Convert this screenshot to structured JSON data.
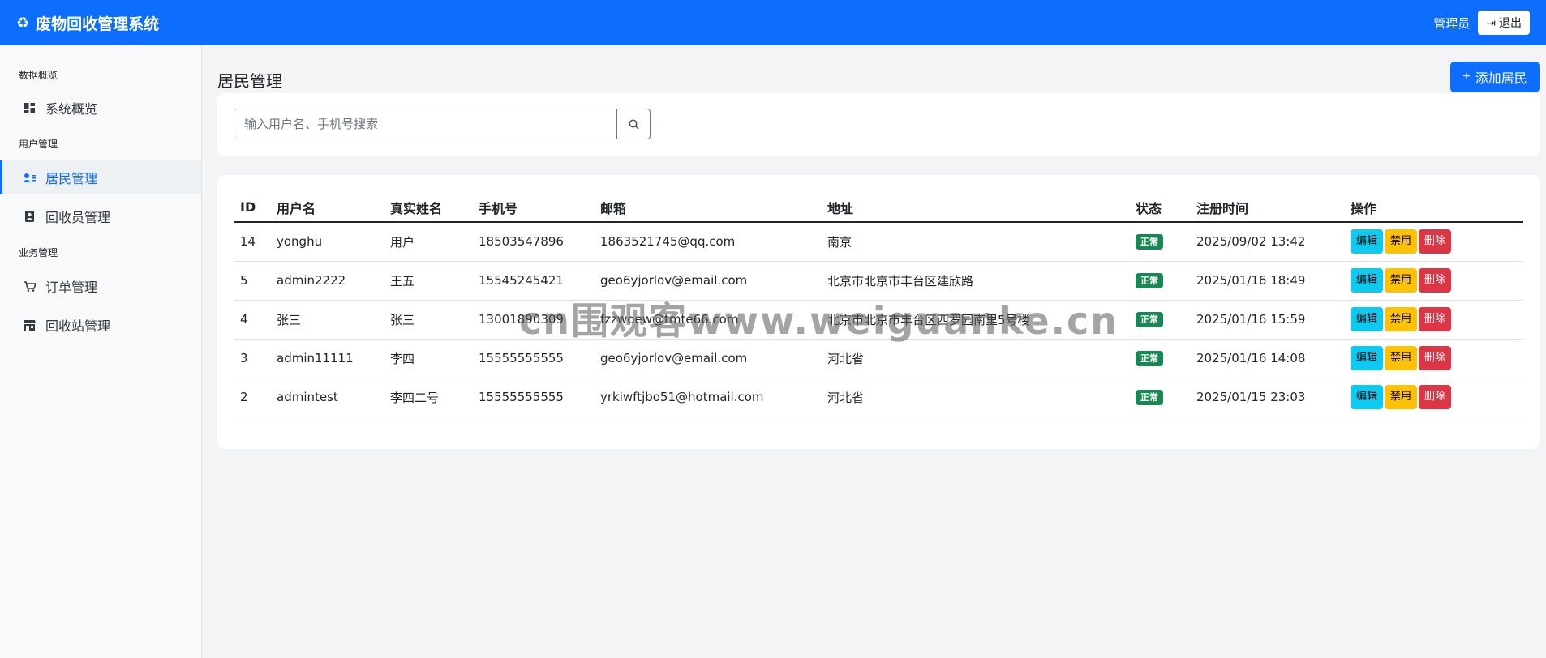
{
  "app": {
    "title": "废物回收管理系统"
  },
  "header": {
    "user": "管理员",
    "logout_label": "退出"
  },
  "sidebar": {
    "sections": [
      {
        "heading": "数据概览"
      },
      {
        "heading": "用户管理"
      },
      {
        "heading": "业务管理"
      }
    ],
    "items": [
      {
        "label": "系统概览",
        "icon": "dashboard-icon"
      },
      {
        "label": "居民管理",
        "icon": "residents-icon",
        "active": true
      },
      {
        "label": "回收员管理",
        "icon": "collector-badge-icon"
      },
      {
        "label": "订单管理",
        "icon": "cart-icon"
      },
      {
        "label": "回收站管理",
        "icon": "shop-icon"
      }
    ]
  },
  "main": {
    "title": "居民管理",
    "add_label": "添加居民",
    "search": {
      "placeholder": "输入用户名、手机号搜索",
      "value": ""
    },
    "table": {
      "columns": [
        "ID",
        "用户名",
        "真实姓名",
        "手机号",
        "邮箱",
        "地址",
        "状态",
        "注册时间",
        "操作"
      ],
      "rows": [
        {
          "id": "14",
          "username": "yonghu",
          "realname": "用户",
          "phone": "18503547896",
          "email": "1863521745@qq.com",
          "address": "南京",
          "status": "正常",
          "registered": "2025/09/02 13:42"
        },
        {
          "id": "5",
          "username": "admin2222",
          "realname": "王五",
          "phone": "15545245421",
          "email": "geo6yjorlov@email.com",
          "address": "北京市北京市丰台区建欣路",
          "status": "正常",
          "registered": "2025/01/16 18:49"
        },
        {
          "id": "4",
          "username": "张三",
          "realname": "张三",
          "phone": "13001890309",
          "email": "fzzwoew@tmte66.com",
          "address": "北京市北京市丰台区西罗园南里5号楼",
          "status": "正常",
          "registered": "2025/01/16 15:59"
        },
        {
          "id": "3",
          "username": "admin11111",
          "realname": "李四",
          "phone": "15555555555",
          "email": "geo6yjorlov@email.com",
          "address": "河北省",
          "status": "正常",
          "registered": "2025/01/16 14:08"
        },
        {
          "id": "2",
          "username": "admintest",
          "realname": "李四二号",
          "phone": "15555555555",
          "email": "yrkiwftjbo51@hotmail.com",
          "address": "河北省",
          "status": "正常",
          "registered": "2025/01/15 23:03"
        }
      ],
      "actions": {
        "edit": "编辑",
        "disable": "禁用",
        "delete": "删除"
      }
    }
  },
  "watermark": "cn围观客www.weiguanke.cn",
  "colors": {
    "primary": "#0d6efd",
    "success": "#198754",
    "info": "#0dcaf0",
    "warning": "#ffc107",
    "danger": "#dc3545"
  }
}
